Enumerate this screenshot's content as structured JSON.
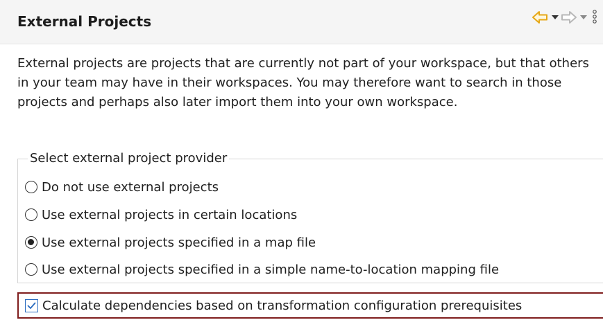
{
  "header": {
    "title": "External Projects"
  },
  "description": "External projects are projects that are currently not part of your workspace, but that others in your team may have in their workspaces. You may therefore want to search in those projects and perhaps also later import them into your own workspace.",
  "provider_group": {
    "legend": "Select external project provider",
    "options": [
      {
        "label": "Do not use external projects",
        "selected": false
      },
      {
        "label": "Use external projects in certain locations",
        "selected": false
      },
      {
        "label": "Use external projects specified in a map file",
        "selected": true
      },
      {
        "label": "Use external projects specified in a simple name-to-location mapping file",
        "selected": false
      }
    ]
  },
  "dependency_checkbox": {
    "label": "Calculate dependencies based on transformation configuration prerequisites",
    "checked": true
  },
  "colors": {
    "back_arrow": "#e6a817",
    "forward_arrow": "#b8b8b8",
    "highlight_border": "#7f1d1d",
    "checkbox_accent": "#2a6bbf"
  },
  "icons": {
    "back": "arrow-left-outline-icon",
    "back_menu": "chevron-down-icon",
    "forward": "arrow-right-outline-icon",
    "forward_menu": "chevron-down-icon",
    "view_menu": "vertical-dots-icon"
  }
}
